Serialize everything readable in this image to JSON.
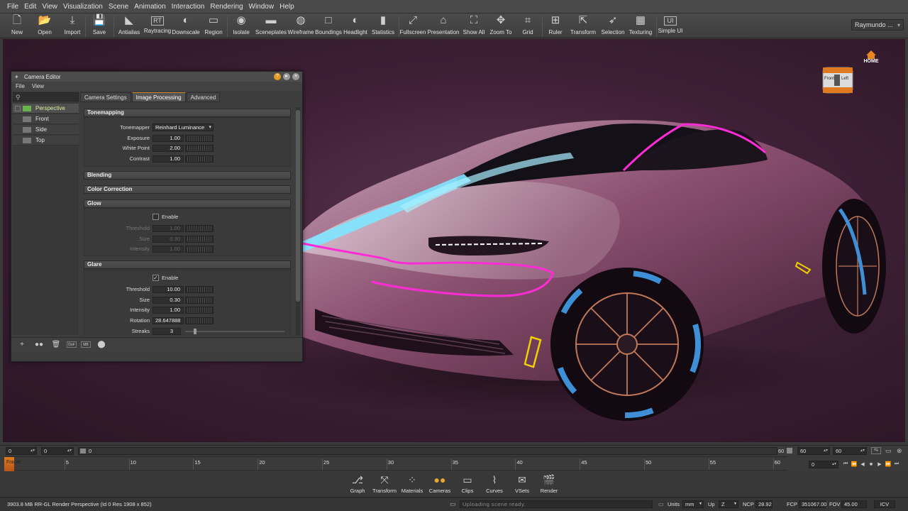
{
  "menubar": [
    "File",
    "Edit",
    "View",
    "Visualization",
    "Scene",
    "Animation",
    "Interaction",
    "Rendering",
    "Window",
    "Help"
  ],
  "toolbar": [
    {
      "label": "New",
      "icon": "new-file-icon",
      "glyph": "🗋"
    },
    {
      "label": "Open",
      "icon": "folder-icon",
      "glyph": "📂"
    },
    {
      "label": "Import",
      "icon": "import-icon",
      "glyph": "⤓"
    },
    {
      "label": "Save",
      "icon": "save-icon",
      "glyph": "💾"
    },
    {
      "label": "Antialias",
      "icon": "antialias-icon",
      "glyph": "◣"
    },
    {
      "label": "Raytracing",
      "icon": "raytracing-icon",
      "glyph": "RT"
    },
    {
      "label": "Downscale",
      "icon": "downscale-icon",
      "glyph": "◐"
    },
    {
      "label": "Region",
      "icon": "region-icon",
      "glyph": "▭"
    },
    {
      "label": "Isolate",
      "icon": "isolate-icon",
      "glyph": "◉"
    },
    {
      "label": "Sceneplates",
      "icon": "sceneplates-icon",
      "glyph": "▬"
    },
    {
      "label": "Wireframe",
      "icon": "wireframe-icon",
      "glyph": "◍"
    },
    {
      "label": "Boundings",
      "icon": "boundings-icon",
      "glyph": "□"
    },
    {
      "label": "Headlight",
      "icon": "headlight-icon",
      "glyph": "◐"
    },
    {
      "label": "Statistics",
      "icon": "statistics-icon",
      "glyph": "▮"
    },
    {
      "label": "Fullscreen",
      "icon": "fullscreen-icon",
      "glyph": "⤢"
    },
    {
      "label": "Presentation",
      "icon": "presentation-icon",
      "glyph": "⌂"
    },
    {
      "label": "Show All",
      "icon": "show-all-icon",
      "glyph": "⛶"
    },
    {
      "label": "Zoom To",
      "icon": "zoom-to-icon",
      "glyph": "✥"
    },
    {
      "label": "Grid",
      "icon": "grid-icon",
      "glyph": "⌗"
    },
    {
      "label": "Ruler",
      "icon": "ruler-icon",
      "glyph": "⊞"
    },
    {
      "label": "Transform",
      "icon": "transform-icon",
      "glyph": "⇱"
    },
    {
      "label": "Selection",
      "icon": "selection-icon",
      "glyph": "➶"
    },
    {
      "label": "Texturing",
      "icon": "texturing-icon",
      "glyph": "▦"
    },
    {
      "label": "Simple UI",
      "icon": "simple-ui-icon",
      "glyph": "UI"
    }
  ],
  "user": "Raymundo ...",
  "viewport": {
    "home_label": "HOME",
    "cube_front": "Front",
    "cube_left": "Left"
  },
  "camera_editor": {
    "title": "Camera Editor",
    "menu": [
      "File",
      "View"
    ],
    "cameras": [
      "Perspective",
      "Front",
      "Side",
      "Top"
    ],
    "tabs": [
      "Camera Settings",
      "Image Processing",
      "Advanced"
    ],
    "sections": {
      "tonemapping": {
        "title": "Tonemapping",
        "tonemapper_label": "Tonemapper",
        "tonemapper_value": "Reinhard Luminance",
        "exposure_label": "Exposure",
        "exposure_value": "1.00",
        "whitepoint_label": "White Point",
        "whitepoint_value": "2.00",
        "contrast_label": "Contrast",
        "contrast_value": "1.00"
      },
      "blending": {
        "title": "Blending"
      },
      "color_correction": {
        "title": "Color Correction"
      },
      "glow": {
        "title": "Glow",
        "enable_label": "Enable",
        "enabled": false,
        "threshold_label": "Threshold",
        "threshold_value": "1.00",
        "size_label": "Size",
        "size_value": "0.30",
        "intensity_label": "Intensity",
        "intensity_value": "1.00"
      },
      "glare": {
        "title": "Glare",
        "enable_label": "Enable",
        "enabled": true,
        "threshold_label": "Threshold",
        "threshold_value": "10.00",
        "size_label": "Size",
        "size_value": "0.30",
        "intensity_label": "Intensity",
        "intensity_value": "1.00",
        "rotation_label": "Rotation",
        "rotation_value": "28.647888",
        "streaks_label": "Streaks",
        "streaks_value": "3"
      }
    },
    "bottom_labels": {
      "dof": "DoF",
      "mb": "MB"
    }
  },
  "timeline": {
    "start": "0",
    "current": "0",
    "slider_value": "0",
    "end_label": "60",
    "end_a": "60",
    "end_b": "60",
    "frame_label": "Frame",
    "ticks": [
      "5",
      "10",
      "15",
      "20",
      "25",
      "30",
      "35",
      "40",
      "45",
      "50",
      "55",
      "60"
    ],
    "current_frame": "0"
  },
  "modules": [
    {
      "label": "Graph",
      "icon": "graph-icon",
      "glyph": "⎇"
    },
    {
      "label": "Transform",
      "icon": "transform-module-icon",
      "glyph": "⤧"
    },
    {
      "label": "Materials",
      "icon": "materials-icon",
      "glyph": "⁘"
    },
    {
      "label": "Cameras",
      "icon": "cameras-icon",
      "glyph": "●●",
      "active": true
    },
    {
      "label": "Clips",
      "icon": "clips-icon",
      "glyph": "▭"
    },
    {
      "label": "Curves",
      "icon": "curves-icon",
      "glyph": "⌇"
    },
    {
      "label": "VSets",
      "icon": "vsets-icon",
      "glyph": "✉"
    },
    {
      "label": "Render",
      "icon": "render-icon",
      "glyph": "🎬"
    }
  ],
  "status": {
    "info": "3903.8 MB  RR-GL  Render Perspective (Id 0 Res 1908 x 852)",
    "message": "Uploading scene ready.",
    "units_label": "Units",
    "units_value": "mm",
    "up_label": "Up",
    "up_value": "Z",
    "ncp_label": "NCP",
    "ncp_value": "28.92",
    "fcp_label": "FCP",
    "fcp_value": "351067.00",
    "fov_label": "FOV",
    "fov_value": "45.00",
    "icv_value": "ICV"
  }
}
